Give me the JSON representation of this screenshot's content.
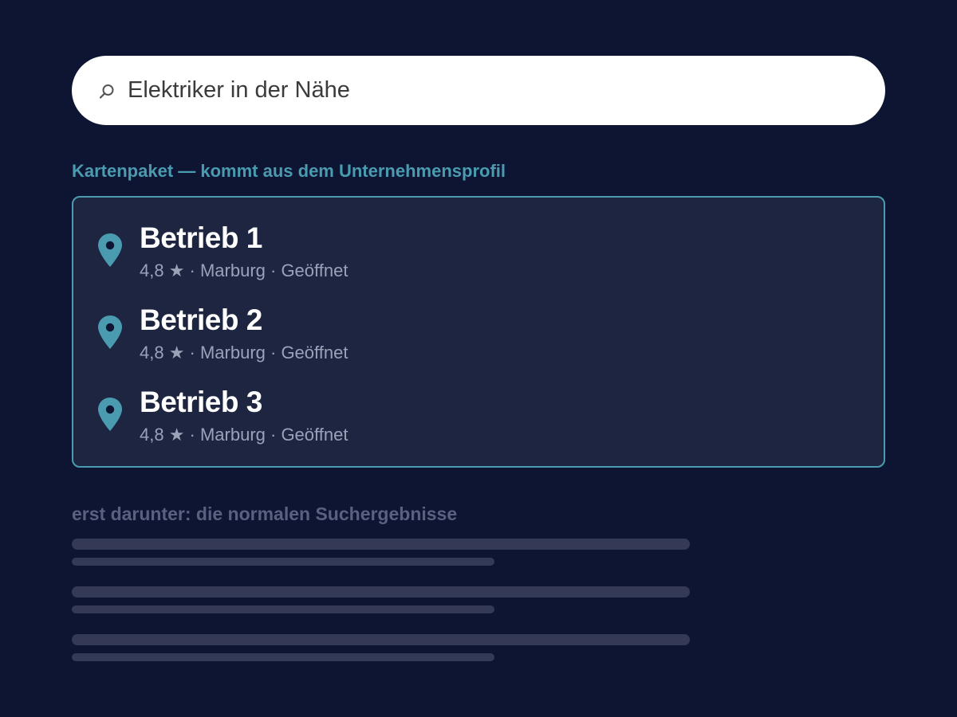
{
  "search": {
    "query": "Elektriker in der Nähe",
    "icon": "search-icon"
  },
  "map_pack": {
    "section_label": "Kartenpaket — kommt aus dem Unternehmensprofil",
    "accent_color": "#4a9bb0",
    "pin_icon": "map-pin-icon",
    "listings": [
      {
        "name": "Betrieb 1",
        "meta": "4,8 ★ · Marburg · Geöffnet"
      },
      {
        "name": "Betrieb 2",
        "meta": "4,8 ★ · Marburg · Geöffnet"
      },
      {
        "name": "Betrieb 3",
        "meta": "4,8 ★ · Marburg · Geöffnet"
      }
    ]
  },
  "results": {
    "section_label": "erst darunter: die normalen Suchergebnisse",
    "placeholder_count": 3
  },
  "colors": {
    "background": "#0e1533",
    "panel": "#1e2541",
    "placeholder": "#343a55"
  }
}
